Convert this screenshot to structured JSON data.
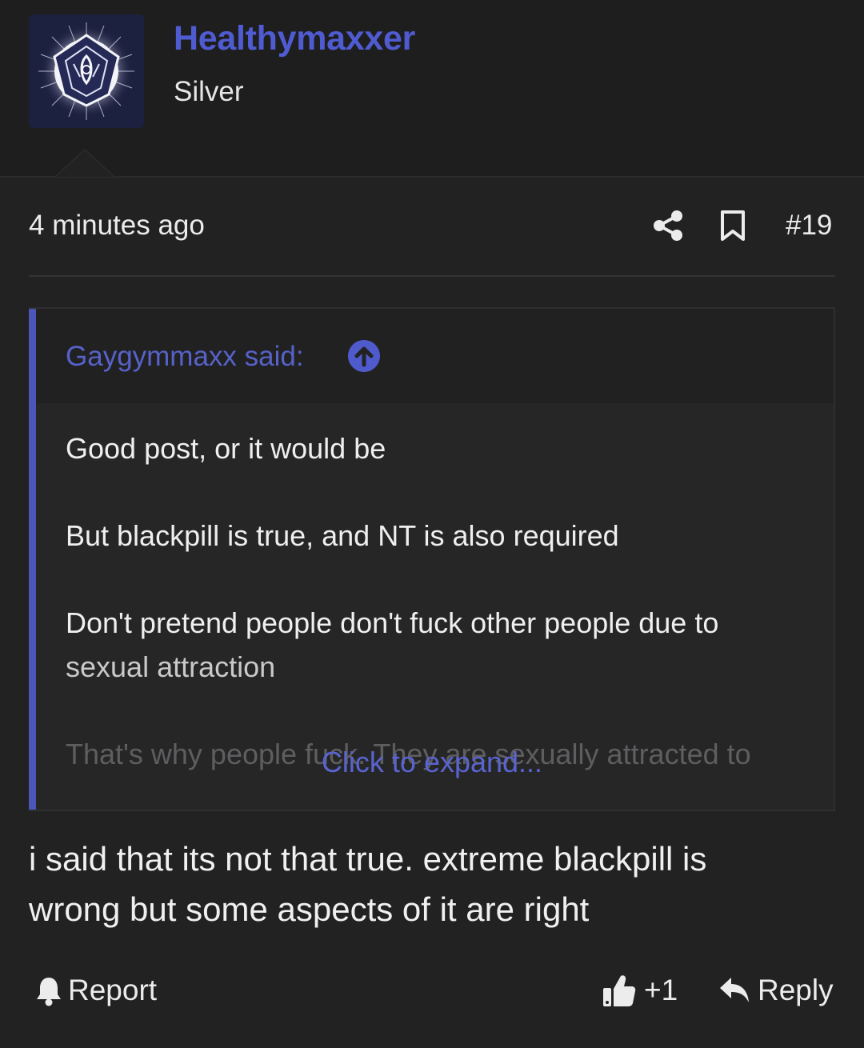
{
  "post": {
    "author": {
      "name": "Healthymaxxer",
      "rank": "Silver",
      "avatar_icon": "geometric-star-emblem-icon"
    },
    "meta": {
      "timestamp": "4 minutes ago",
      "post_number": "#19",
      "share_icon": "share-icon",
      "bookmark_icon": "bookmark-icon"
    },
    "quote": {
      "author_line": "Gaygymmaxx said:",
      "jump_icon": "arrow-up-circle-icon",
      "lines": [
        "Good post, or it would be",
        "But blackpill is true, and NT is also required",
        "Don't pretend people don't fuck other people due to",
        "sexual attraction",
        "That's why people fuck. They are sexually attracted to"
      ],
      "expand_label": "Click to expand..."
    },
    "message": {
      "line1": "i said that its not that true. extreme blackpill is",
      "line2": "wrong but some aspects of it are right"
    },
    "actions": {
      "report_label": "Report",
      "report_icon": "bell-icon",
      "like_count": "+1",
      "like_icon": "thumbs-up-icon",
      "reply_label": "Reply",
      "reply_icon": "reply-arrow-icon"
    }
  },
  "colors": {
    "background": "#222223",
    "accent": "#4f5bd0",
    "quote_bar": "#4c55b8",
    "text": "#ececec"
  }
}
